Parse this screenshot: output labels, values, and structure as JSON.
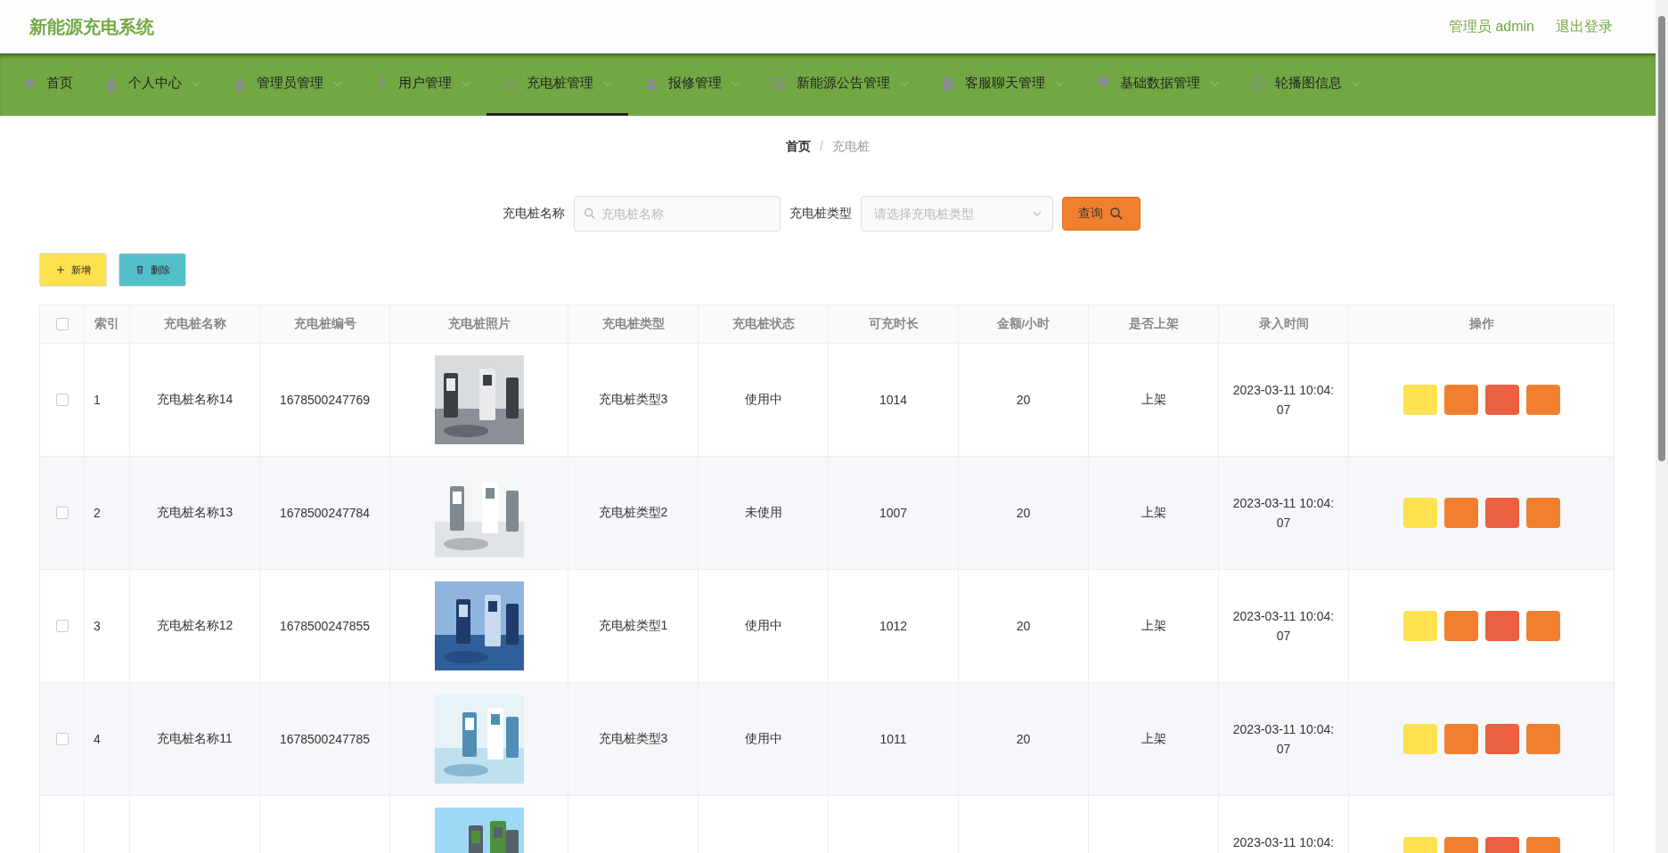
{
  "header": {
    "title": "新能源充电系统",
    "user": "管理员 admin",
    "logout": "退出登录"
  },
  "nav": [
    {
      "label": "首页",
      "dropdown": false,
      "selected": false
    },
    {
      "label": "个人中心",
      "dropdown": true,
      "selected": false
    },
    {
      "label": "管理员管理",
      "dropdown": true,
      "selected": false
    },
    {
      "label": "用户管理",
      "dropdown": true,
      "selected": false
    },
    {
      "label": "充电桩管理",
      "dropdown": true,
      "selected": true
    },
    {
      "label": "报修管理",
      "dropdown": true,
      "selected": false
    },
    {
      "label": "新能源公告管理",
      "dropdown": true,
      "selected": false
    },
    {
      "label": "客服聊天管理",
      "dropdown": true,
      "selected": false
    },
    {
      "label": "基础数据管理",
      "dropdown": true,
      "selected": false
    },
    {
      "label": "轮播图信息",
      "dropdown": true,
      "selected": false
    }
  ],
  "breadcrumb": {
    "items": [
      "首页",
      "充电桩"
    ],
    "separator": "/"
  },
  "search": {
    "fields": [
      {
        "kind": "input",
        "label": "充电桩名称",
        "placeholder": "充电桩名称"
      },
      {
        "kind": "select",
        "label": "充电桩类型",
        "placeholder": "请选择充电桩类型"
      }
    ],
    "button": "查询"
  },
  "toolbar": [
    {
      "kind": "add",
      "label": "新增"
    },
    {
      "kind": "delete",
      "label": "删除"
    }
  ],
  "table": {
    "select_all": {
      "checked": false
    },
    "columns": [
      "索引",
      "充电桩名称",
      "充电桩编号",
      "充电桩照片",
      "充电桩类型",
      "充电桩状态",
      "可充时长",
      "金额/小时",
      "是否上架",
      "录入时间",
      "操作"
    ],
    "rows": [
      {
        "checked": false,
        "index": "1",
        "name": "充电桩名称14",
        "code": "1678500247769",
        "photo": {
          "kind": "picture"
        },
        "type": "充电桩类型3",
        "status": "使用中",
        "duration": "1014",
        "price": "20",
        "listed": "上架",
        "time": "2023-03-11 10:04:07",
        "actions": [
          {
            "color": "#fde14f"
          },
          {
            "color": "#f08030"
          },
          {
            "color": "#ea6040"
          },
          {
            "color": "#f08030"
          }
        ]
      },
      {
        "checked": false,
        "index": "2",
        "name": "充电桩名称13",
        "code": "1678500247784",
        "photo": {
          "kind": "picture"
        },
        "type": "充电桩类型2",
        "status": "未使用",
        "duration": "1007",
        "price": "20",
        "listed": "上架",
        "time": "2023-03-11 10:04:07",
        "actions": [
          {
            "color": "#fde14f"
          },
          {
            "color": "#f08030"
          },
          {
            "color": "#ea6040"
          },
          {
            "color": "#f08030"
          }
        ]
      },
      {
        "checked": false,
        "index": "3",
        "name": "充电桩名称12",
        "code": "1678500247855",
        "photo": {
          "kind": "picture"
        },
        "type": "充电桩类型1",
        "status": "使用中",
        "duration": "1012",
        "price": "20",
        "listed": "上架",
        "time": "2023-03-11 10:04:07",
        "actions": [
          {
            "color": "#fde14f"
          },
          {
            "color": "#f08030"
          },
          {
            "color": "#ea6040"
          },
          {
            "color": "#f08030"
          }
        ]
      },
      {
        "checked": false,
        "index": "4",
        "name": "充电桩名称11",
        "code": "1678500247785",
        "photo": {
          "kind": "picture"
        },
        "type": "充电桩类型3",
        "status": "使用中",
        "duration": "1011",
        "price": "20",
        "listed": "上架",
        "time": "2023-03-11 10:04:07",
        "actions": [
          {
            "color": "#fde14f"
          },
          {
            "color": "#f08030"
          },
          {
            "color": "#ea6040"
          },
          {
            "color": "#f08030"
          }
        ]
      },
      {
        "photo": {
          "kind": "picture"
        },
        "time": "2023-03-11 10:04:",
        "actions": [
          {
            "color": "#fde14f"
          },
          {
            "color": "#f08030"
          },
          {
            "color": "#ea6040"
          },
          {
            "color": "#f08030"
          }
        ]
      }
    ]
  }
}
